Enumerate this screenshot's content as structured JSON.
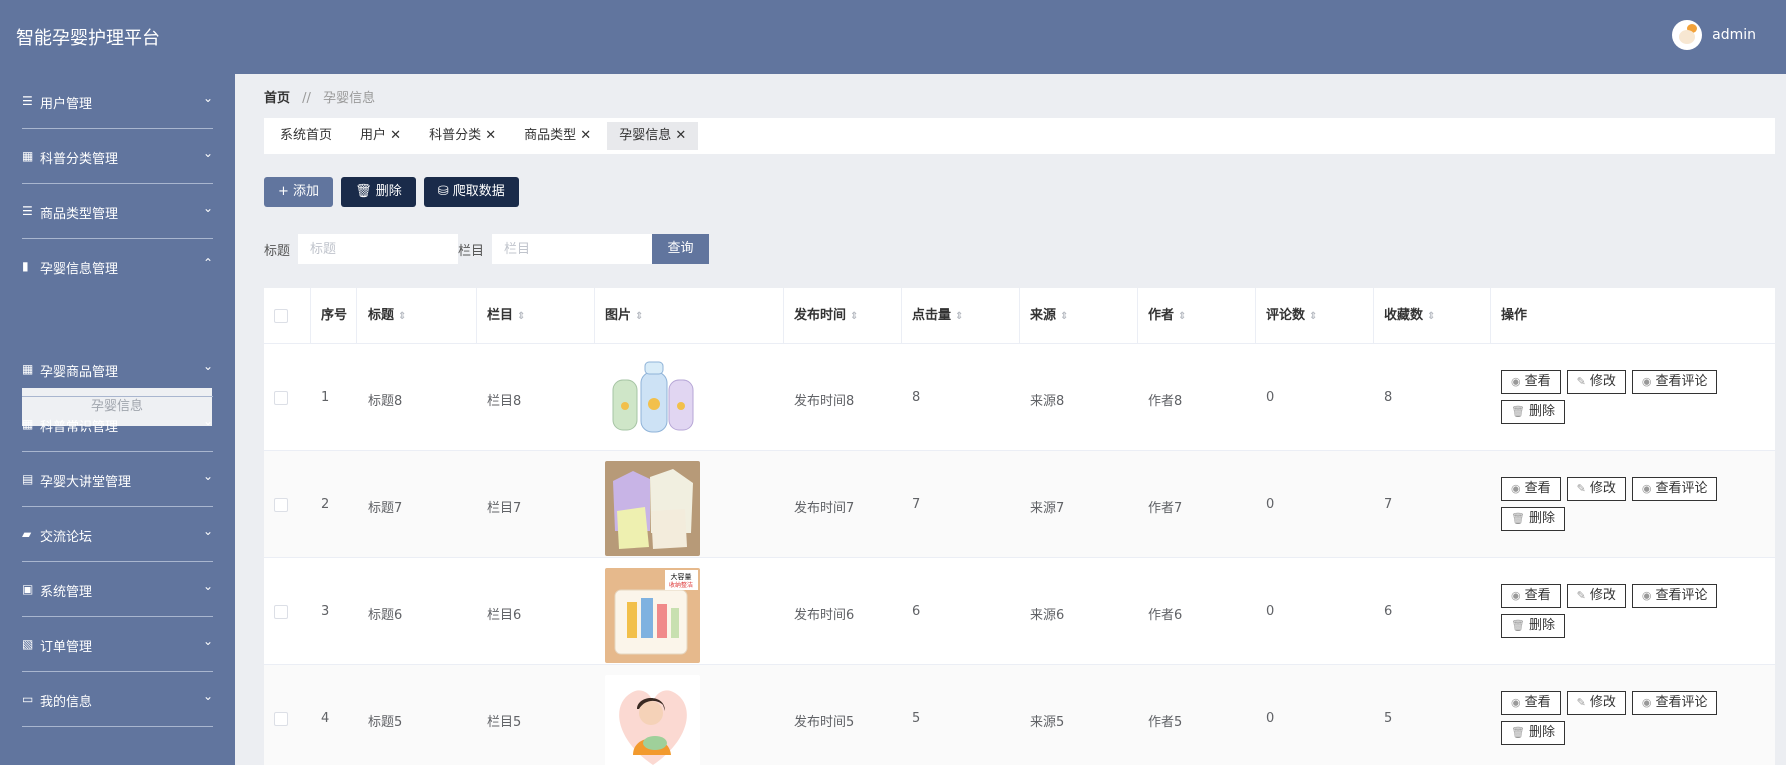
{
  "app": {
    "title": "智能孕婴护理平台",
    "user": "admin"
  },
  "sidebar": {
    "items": [
      {
        "label": "用户管理",
        "icon": "list-icon",
        "glyph": "☰",
        "chev": "⌄"
      },
      {
        "label": "科普分类管理",
        "icon": "grid-icon",
        "glyph": "▦",
        "chev": "⌄"
      },
      {
        "label": "商品类型管理",
        "icon": "list-icon",
        "glyph": "☰",
        "chev": "⌄"
      },
      {
        "label": "孕婴信息管理",
        "icon": "book-icon",
        "glyph": "▮",
        "chev": "⌃"
      },
      {
        "label": "孕婴商品管理",
        "icon": "grid-icon",
        "glyph": "▦",
        "chev": "⌄"
      },
      {
        "label": "科普常识管理",
        "icon": "grid-icon",
        "glyph": "▦",
        "chev": "⌄"
      },
      {
        "label": "孕婴大讲堂管理",
        "icon": "clipboard-icon",
        "glyph": "▤",
        "chev": "⌄"
      },
      {
        "label": "交流论坛",
        "icon": "thumb-icon",
        "glyph": "▰",
        "chev": "⌄"
      },
      {
        "label": "系统管理",
        "icon": "briefcase-icon",
        "glyph": "▣",
        "chev": "⌄"
      },
      {
        "label": "订单管理",
        "icon": "order-icon",
        "glyph": "▧",
        "chev": "⌄"
      },
      {
        "label": "我的信息",
        "icon": "card-icon",
        "glyph": "▭",
        "chev": "⌄"
      }
    ],
    "subitem": "孕婴信息"
  },
  "breadcrumb": {
    "home": "首页",
    "sep": "//",
    "current": "孕婴信息"
  },
  "tabs": [
    {
      "label": "系统首页",
      "close": ""
    },
    {
      "label": "用户",
      "close": "✕"
    },
    {
      "label": "科普分类",
      "close": "✕"
    },
    {
      "label": "商品类型",
      "close": "✕"
    },
    {
      "label": "孕婴信息",
      "close": "✕"
    }
  ],
  "toolbar": {
    "add": "添加",
    "delete": "删除",
    "crawl": "爬取数据",
    "add_icon": "+",
    "delete_icon": "🗑",
    "crawl_icon": "⛁"
  },
  "search": {
    "title_label": "标题",
    "title_placeholder": "标题",
    "column_label": "栏目",
    "column_placeholder": "栏目",
    "query": "查询"
  },
  "table": {
    "headers": [
      "序号",
      "标题",
      "栏目",
      "图片",
      "发布时间",
      "点击量",
      "来源",
      "作者",
      "评论数",
      "收藏数",
      "操作"
    ],
    "sort_glyph": "⇕",
    "rows": [
      {
        "no": "1",
        "title": "标题8",
        "column": "栏目8",
        "image": "baby-bottles",
        "publish": "发布时间8",
        "clicks": "8",
        "source": "来源8",
        "author": "作者8",
        "comments": "0",
        "favs": "8"
      },
      {
        "no": "2",
        "title": "标题7",
        "column": "栏目7",
        "image": "baby-clothes",
        "publish": "发布时间7",
        "clicks": "7",
        "source": "来源7",
        "author": "作者7",
        "comments": "0",
        "favs": "7"
      },
      {
        "no": "3",
        "title": "标题6",
        "column": "栏目6",
        "image": "storage-box",
        "publish": "发布时间6",
        "clicks": "6",
        "source": "来源6",
        "author": "作者6",
        "comments": "0",
        "favs": "6"
      },
      {
        "no": "4",
        "title": "标题5",
        "column": "栏目5",
        "image": "mother-baby",
        "publish": "发布时间5",
        "clicks": "5",
        "source": "来源5",
        "author": "作者5",
        "comments": "0",
        "favs": "5"
      }
    ],
    "ops": {
      "view": "查看",
      "edit": "修改",
      "view_comments": "查看评论",
      "delete": "删除",
      "eye_icon": "◉",
      "pen_icon": "✎",
      "trash_icon": "🗑"
    },
    "image_badge_top": "大容量",
    "image_badge_bottom": "收纳整洁"
  },
  "colors": {
    "brand": "#61759e",
    "dark_button": "#1a2b4a"
  }
}
